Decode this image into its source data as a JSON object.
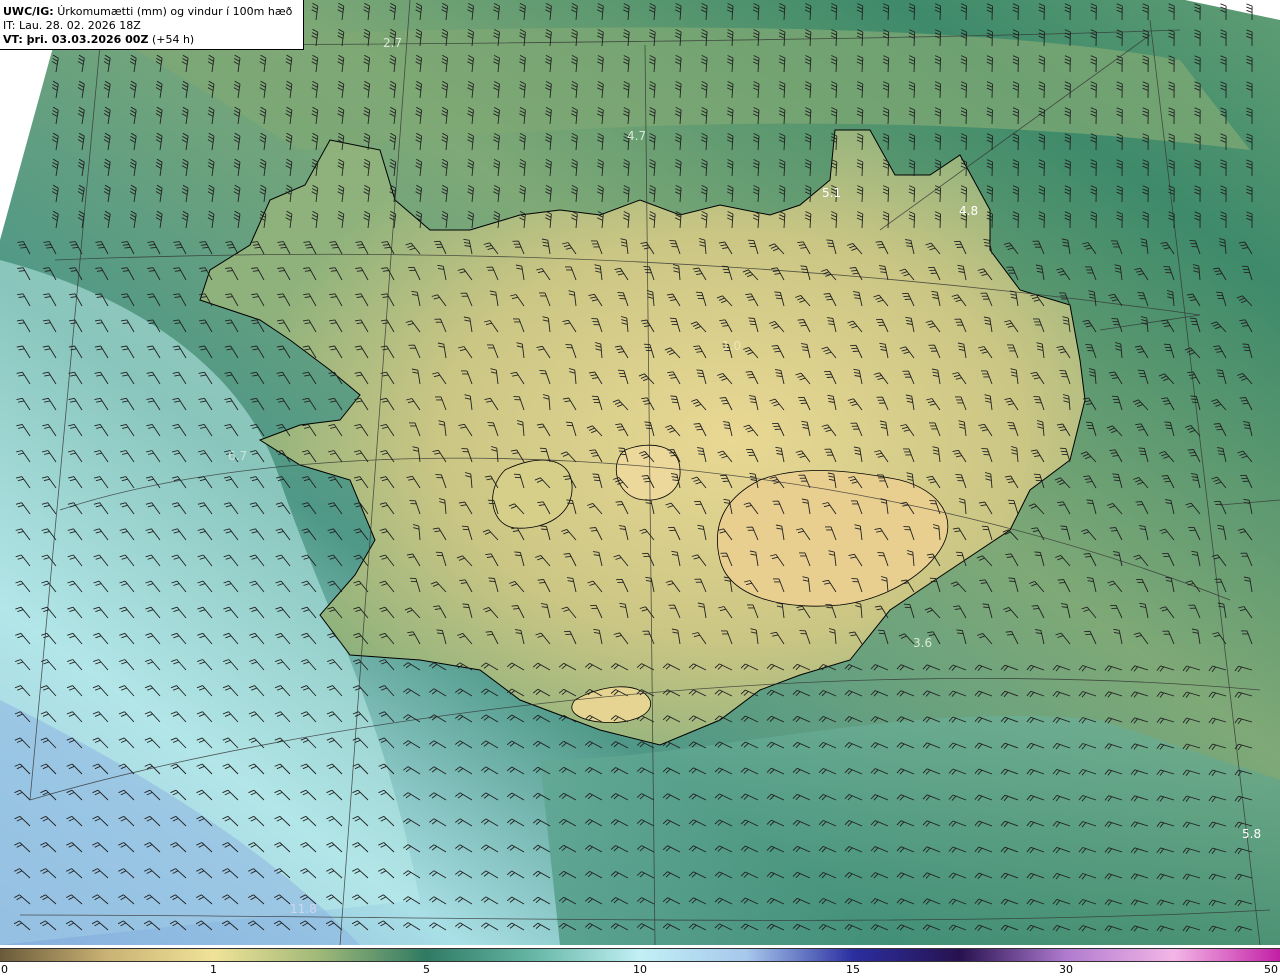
{
  "header": {
    "model": "UWC/IG:",
    "product": "Úrkomumætti (mm) og vindur í 100m hæð",
    "init_time": "IT: Lau. 28. 02. 2026 18Z",
    "valid_label": "VT: þri. 03.03.2026 00Z",
    "valid_offset": "(+54 h)"
  },
  "map_values": {
    "v1": "2.7",
    "v2": "4.7",
    "v3": "5.1",
    "v4": "4.8",
    "v5": "1.0",
    "v6": "6.7",
    "v7": "3.6",
    "v8": "5.8",
    "v9": "11.8"
  },
  "colorbar": {
    "ticks": [
      "0",
      "1",
      "5",
      "10",
      "15",
      "30",
      "50"
    ],
    "colors": [
      "#6b5a3a",
      "#c9b274",
      "#f0e397",
      "#9fb878",
      "#2f7a63",
      "#66b7a6",
      "#c2f0f5",
      "#a6c8ec",
      "#2b2ea0",
      "#27124f",
      "#b07bd0",
      "#f3b6e6",
      "#c21fa6"
    ]
  }
}
